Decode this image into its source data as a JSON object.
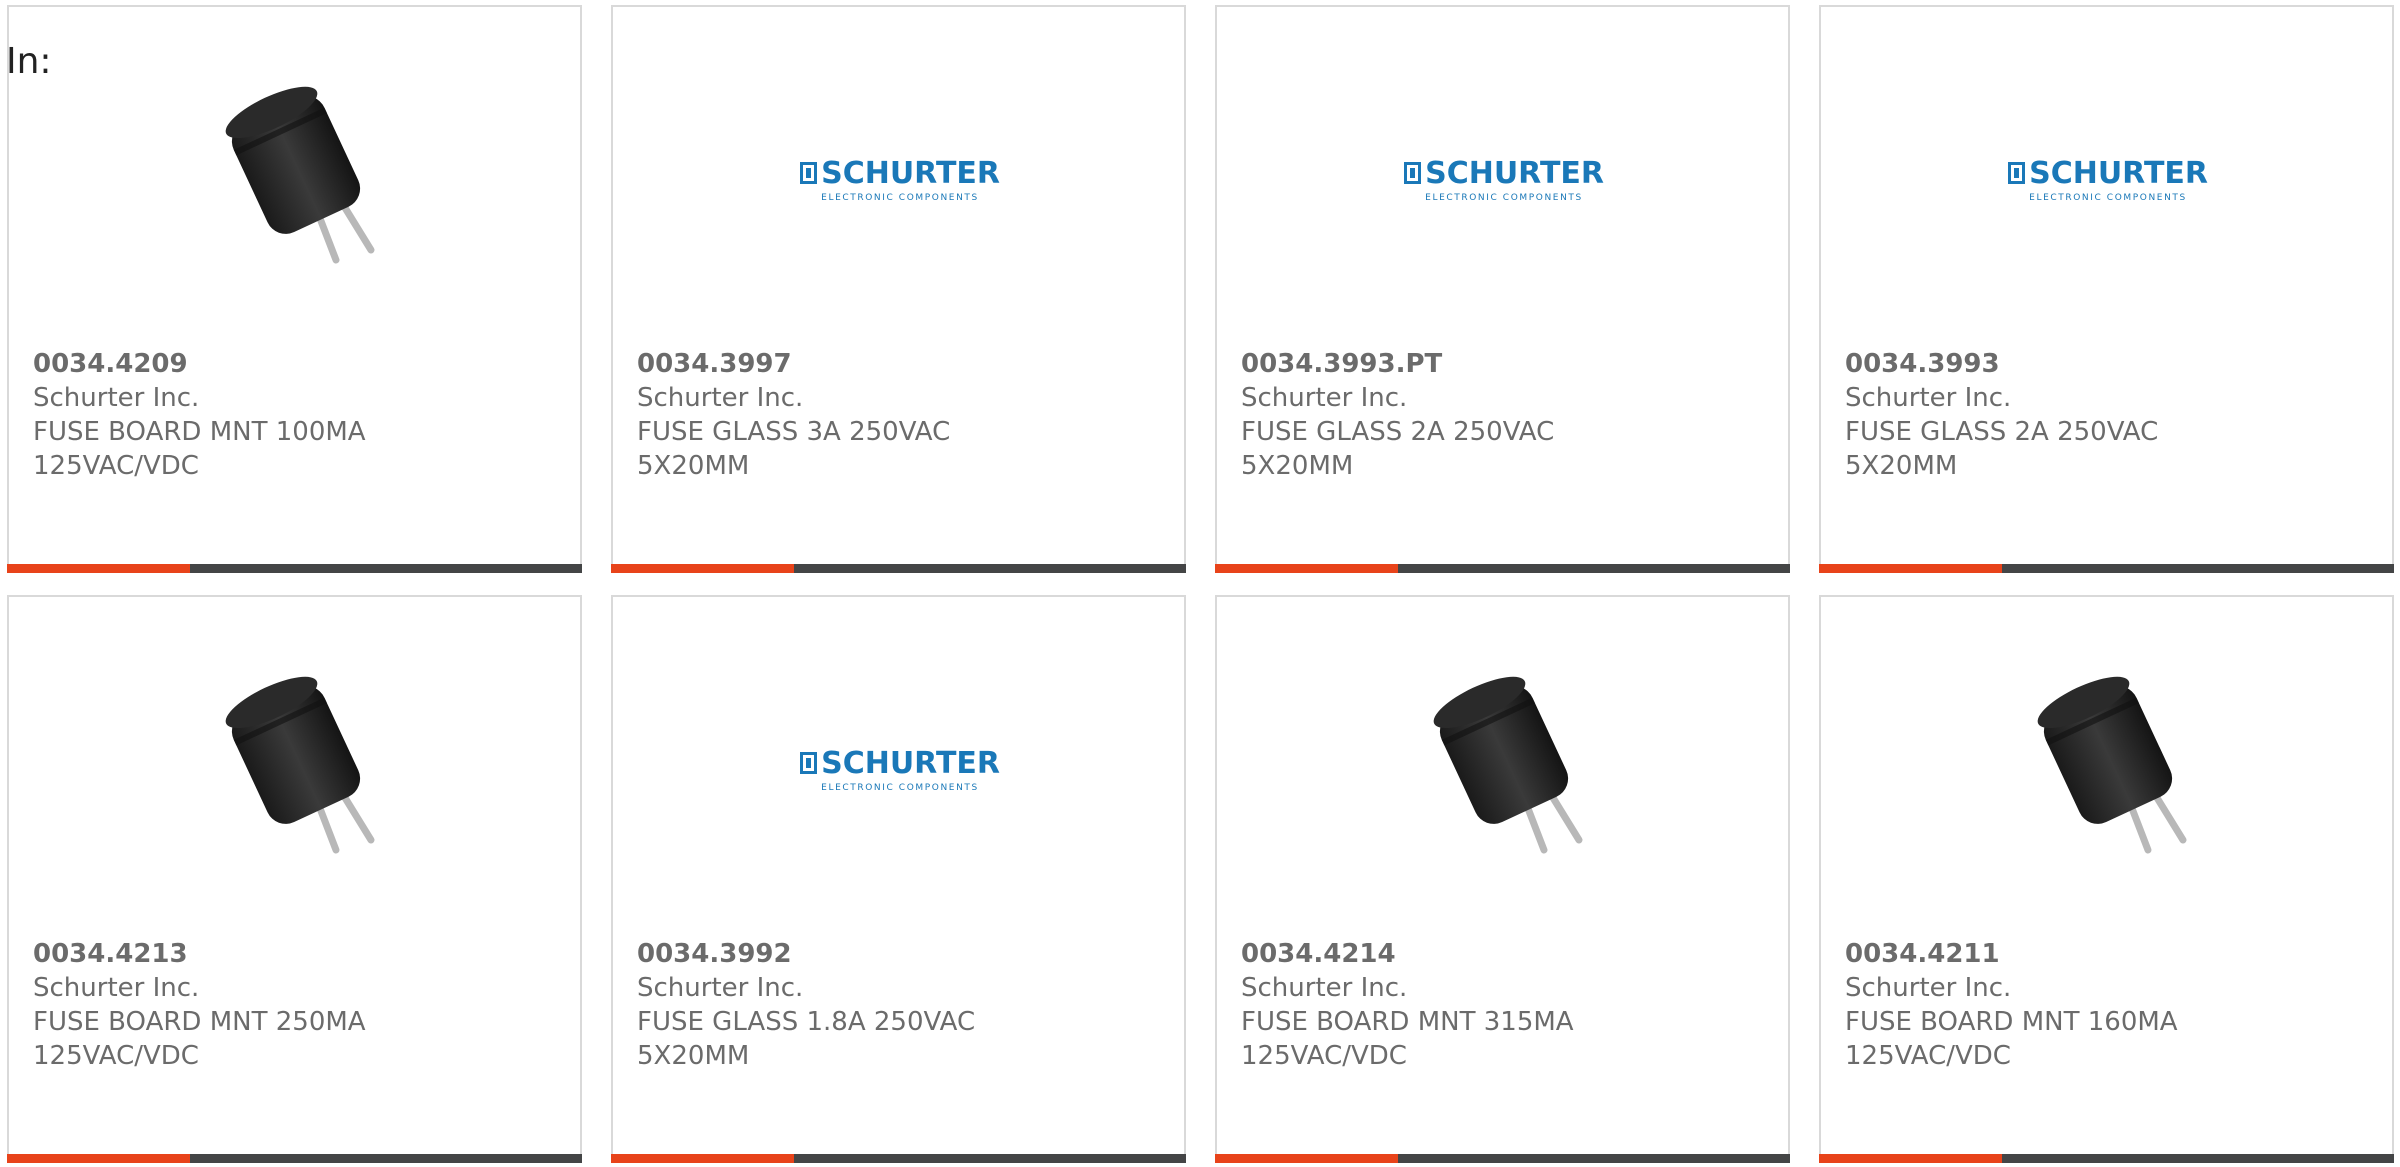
{
  "header": {
    "label": "In:"
  },
  "logo": {
    "main": "SCHURTER",
    "sub": "ELECTRONIC COMPONENTS"
  },
  "colors": {
    "accent": "#e8431a",
    "bar": "#444546",
    "logo": "#1a78b8"
  },
  "products": [
    {
      "part": "0034.4209",
      "manufacturer": "Schurter Inc.",
      "description": "FUSE BOARD MNT 100MA 125VAC/VDC",
      "image": "fuse-board-icon"
    },
    {
      "part": "0034.3997",
      "manufacturer": "Schurter Inc.",
      "description": "FUSE GLASS 3A 250VAC 5X20MM",
      "image": "schurter-logo"
    },
    {
      "part": "0034.3993.PT",
      "manufacturer": "Schurter Inc.",
      "description": "FUSE GLASS 2A 250VAC 5X20MM",
      "image": "schurter-logo"
    },
    {
      "part": "0034.3993",
      "manufacturer": "Schurter Inc.",
      "description": "FUSE GLASS 2A 250VAC 5X20MM",
      "image": "schurter-logo"
    },
    {
      "part": "0034.4213",
      "manufacturer": "Schurter Inc.",
      "description": "FUSE BOARD MNT 250MA 125VAC/VDC",
      "image": "fuse-board-icon"
    },
    {
      "part": "0034.3992",
      "manufacturer": "Schurter Inc.",
      "description": "FUSE GLASS 1.8A 250VAC 5X20MM",
      "image": "schurter-logo"
    },
    {
      "part": "0034.4214",
      "manufacturer": "Schurter Inc.",
      "description": "FUSE BOARD MNT 315MA 125VAC/VDC",
      "image": "fuse-board-icon"
    },
    {
      "part": "0034.4211",
      "manufacturer": "Schurter Inc.",
      "description": "FUSE BOARD MNT 160MA 125VAC/VDC",
      "image": "fuse-board-icon"
    }
  ]
}
